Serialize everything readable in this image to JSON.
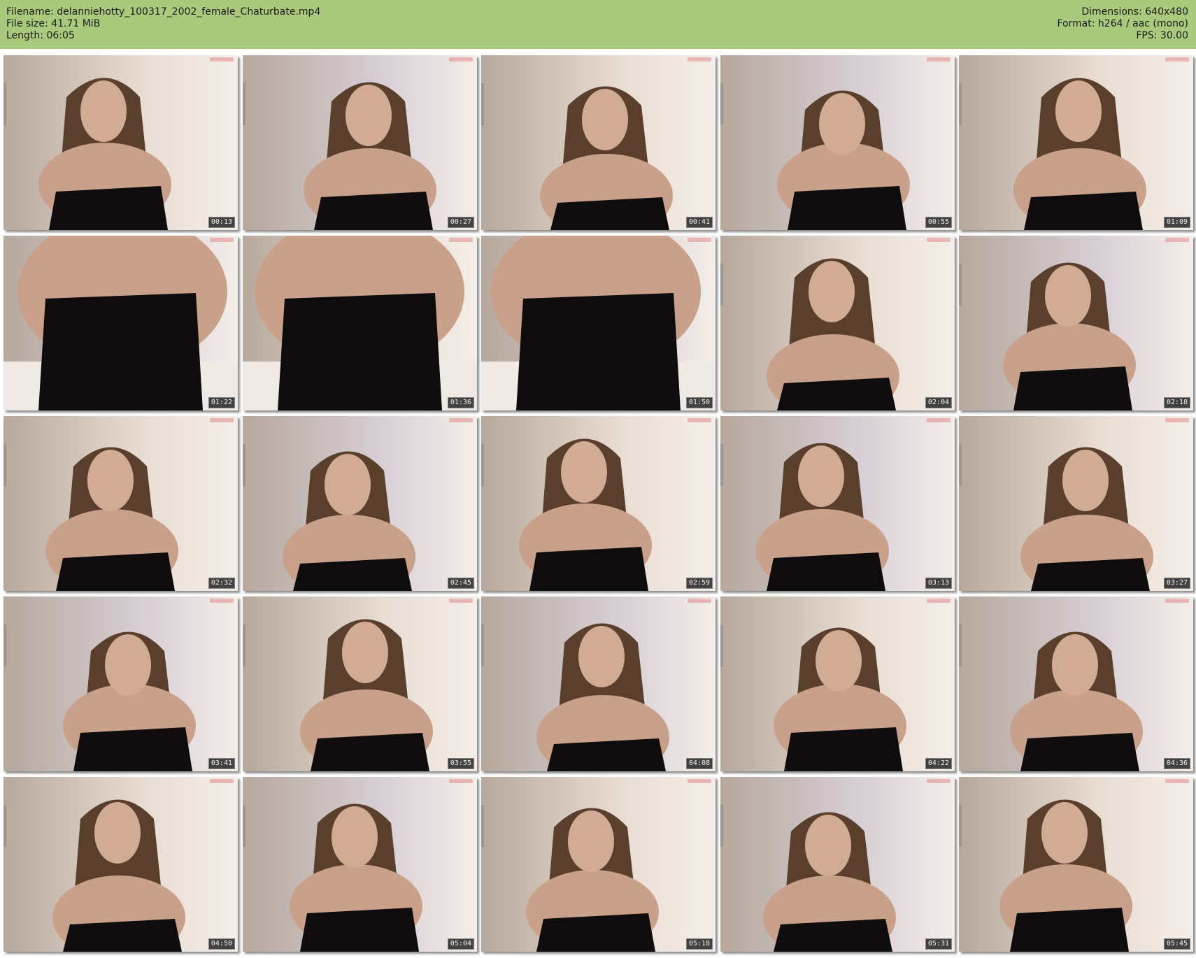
{
  "header": {
    "filename": "Filename: delanniehotty_100317_2002_female_Chaturbate.mp4",
    "filesize": "File size: 41.71 MiB",
    "length": "Length: 06:05",
    "dimensions": "Dimensions: 640x480",
    "format": "Format: h264 / aac (mono)",
    "fps": "FPS: 30.00"
  },
  "colors": {
    "header_bg": "#a9ca7c",
    "dress": "#0e0c0d",
    "skin": "#c9a08a",
    "hair": "#5a3f2c",
    "wall_warm": "#e9ddd3",
    "wall_cool": "#d8cfd6"
  },
  "thumbnails": [
    {
      "time": "00:13"
    },
    {
      "time": "00:27"
    },
    {
      "time": "00:41"
    },
    {
      "time": "00:55"
    },
    {
      "time": "01:09"
    },
    {
      "time": "01:22"
    },
    {
      "time": "01:36"
    },
    {
      "time": "01:50"
    },
    {
      "time": "02:04"
    },
    {
      "time": "02:18"
    },
    {
      "time": "02:32"
    },
    {
      "time": "02:45"
    },
    {
      "time": "02:59"
    },
    {
      "time": "03:13"
    },
    {
      "time": "03:27"
    },
    {
      "time": "03:41"
    },
    {
      "time": "03:55"
    },
    {
      "time": "04:08"
    },
    {
      "time": "04:22"
    },
    {
      "time": "04:36"
    },
    {
      "time": "04:50"
    },
    {
      "time": "05:04"
    },
    {
      "time": "05:18"
    },
    {
      "time": "05:31"
    },
    {
      "time": "05:45"
    }
  ]
}
